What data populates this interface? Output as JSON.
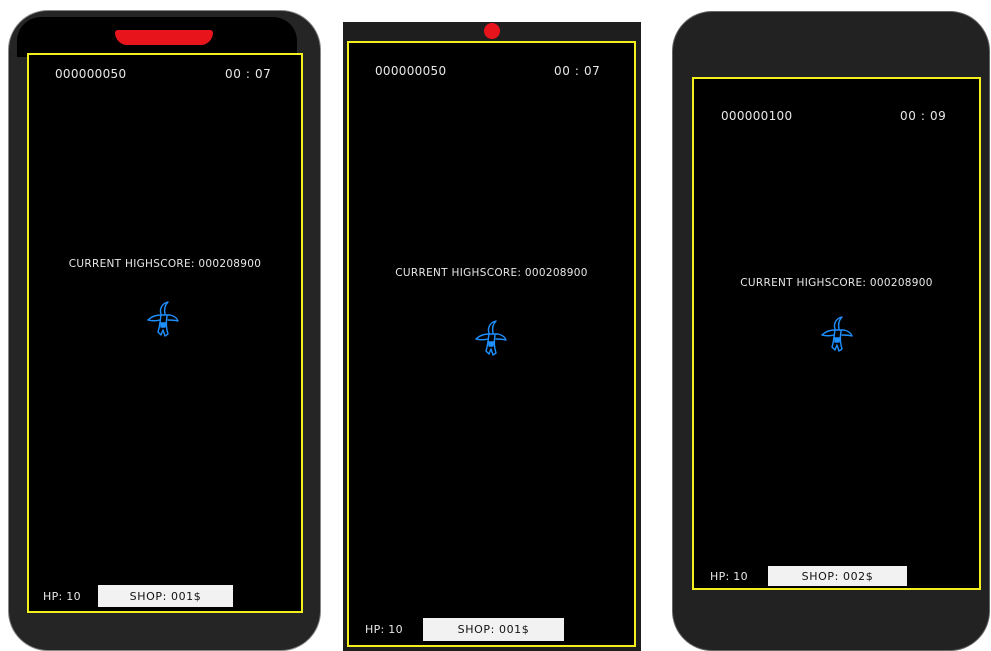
{
  "screens": [
    {
      "score": "000000050",
      "time": "00 : 07",
      "highscore": "CURRENT HIGHSCORE: 000208900",
      "hp": "HP: 10",
      "shop": "SHOP: 001$"
    },
    {
      "score": "000000050",
      "time": "00 : 07",
      "highscore": "CURRENT HIGHSCORE: 000208900",
      "hp": "HP: 10",
      "shop": "SHOP: 001$"
    },
    {
      "score": "000000100",
      "time": "00 : 09",
      "highscore": "CURRENT HIGHSCORE: 000208900",
      "hp": "HP: 10",
      "shop": "SHOP: 002$"
    }
  ],
  "colors": {
    "frame": "#f2ef1c",
    "player": "#1e90ff",
    "marker": "#e8141c",
    "screen_bg": "#000000"
  },
  "icons": {
    "player": "shark-plane-sprite"
  }
}
